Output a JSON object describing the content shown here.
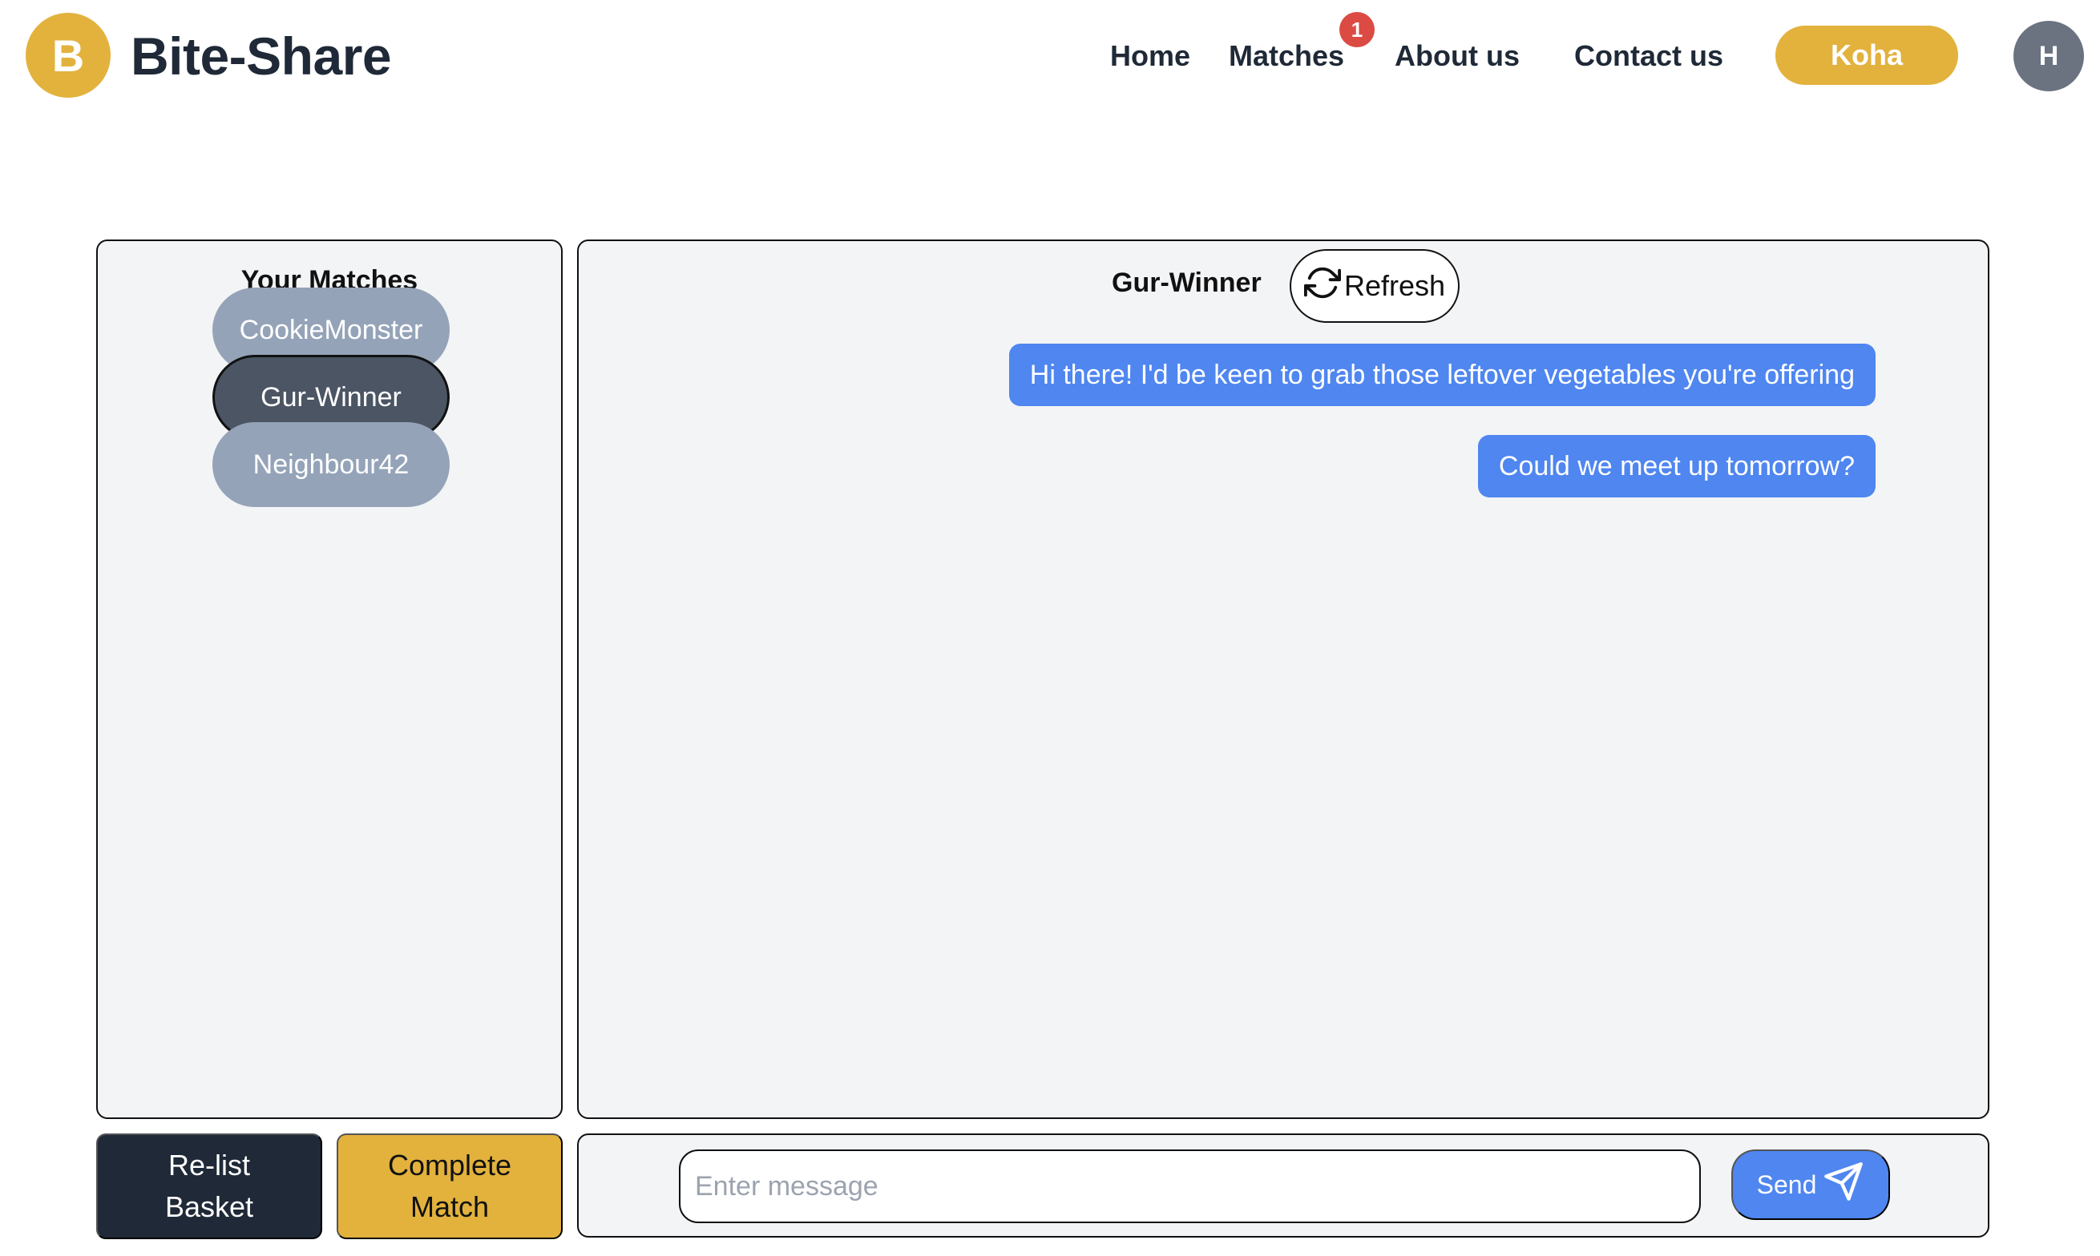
{
  "brand": {
    "logo_letter": "B",
    "name": "Bite-Share",
    "accent_color": "#e2b23d"
  },
  "nav": {
    "home": "Home",
    "matches": "Matches",
    "matches_badge": "1",
    "about": "About us",
    "contact": "Contact us",
    "koha": "Koha",
    "avatar_letter": "H"
  },
  "matches_panel": {
    "title": "Your Matches",
    "items": [
      {
        "label": "CookieMonster",
        "active": false
      },
      {
        "label": "Gur-Winner",
        "active": true
      },
      {
        "label": "Neighbour42",
        "active": false
      }
    ]
  },
  "chat": {
    "title": "Gur-Winner",
    "refresh_label": "Refresh",
    "refresh_icon": "refresh-icon",
    "messages": [
      {
        "text": "Hi there! I'd be keen to grab those leftover vegetables you're offering",
        "sender": "me"
      },
      {
        "text": "Could we meet up tomorrow?",
        "sender": "me"
      }
    ],
    "bubble_color": "#4f86f0"
  },
  "actions": {
    "relist_line1": "Re-list",
    "relist_line2": "Basket",
    "complete_line1": "Complete",
    "complete_line2": "Match"
  },
  "composer": {
    "placeholder": "Enter message",
    "value": "",
    "send_label": "Send",
    "send_icon": "paper-plane-icon"
  }
}
